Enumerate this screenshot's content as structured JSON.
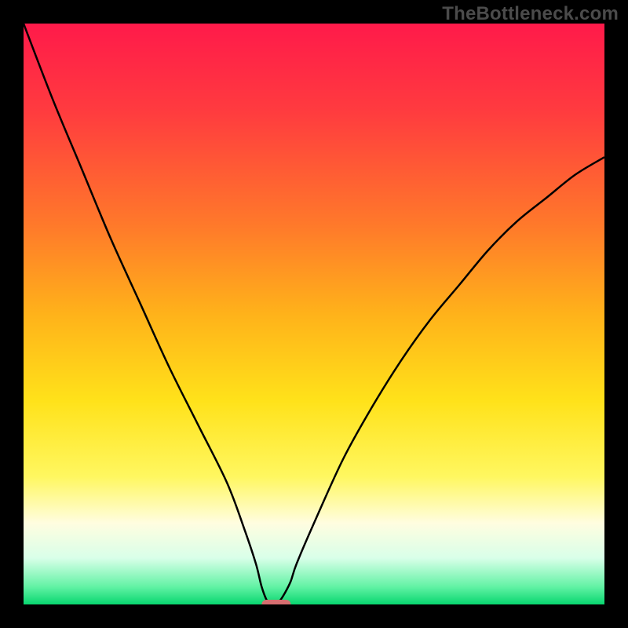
{
  "watermark": "TheBottleneck.com",
  "chart_data": {
    "type": "line",
    "title": "",
    "xlabel": "",
    "ylabel": "",
    "xlim": [
      0,
      100
    ],
    "ylim": [
      0,
      100
    ],
    "x": [
      0,
      5,
      10,
      15,
      20,
      25,
      30,
      35,
      38,
      40,
      41,
      42,
      43,
      44,
      45,
      46,
      47,
      50,
      55,
      60,
      65,
      70,
      75,
      80,
      85,
      90,
      95,
      100
    ],
    "y": [
      100,
      87,
      75,
      63,
      52,
      41,
      31,
      21,
      13,
      7,
      3,
      0.5,
      0,
      0.5,
      2,
      4,
      7,
      14,
      25,
      34,
      42,
      49,
      55,
      61,
      66,
      70,
      74,
      77
    ],
    "marker": {
      "x_range": [
        41,
        46
      ],
      "y": 0,
      "color": "#d66e70"
    },
    "background_gradient": {
      "stops": [
        {
          "offset": 0.0,
          "color": "#ff1a4a"
        },
        {
          "offset": 0.15,
          "color": "#ff3b3f"
        },
        {
          "offset": 0.35,
          "color": "#ff7a2a"
        },
        {
          "offset": 0.5,
          "color": "#ffb21a"
        },
        {
          "offset": 0.65,
          "color": "#ffe21a"
        },
        {
          "offset": 0.78,
          "color": "#fff760"
        },
        {
          "offset": 0.86,
          "color": "#fffde0"
        },
        {
          "offset": 0.92,
          "color": "#d9ffe9"
        },
        {
          "offset": 0.97,
          "color": "#61f2a4"
        },
        {
          "offset": 1.0,
          "color": "#08d66f"
        }
      ]
    },
    "curve_color": "#000000",
    "curve_width": 2.5,
    "marker_height": 12
  }
}
